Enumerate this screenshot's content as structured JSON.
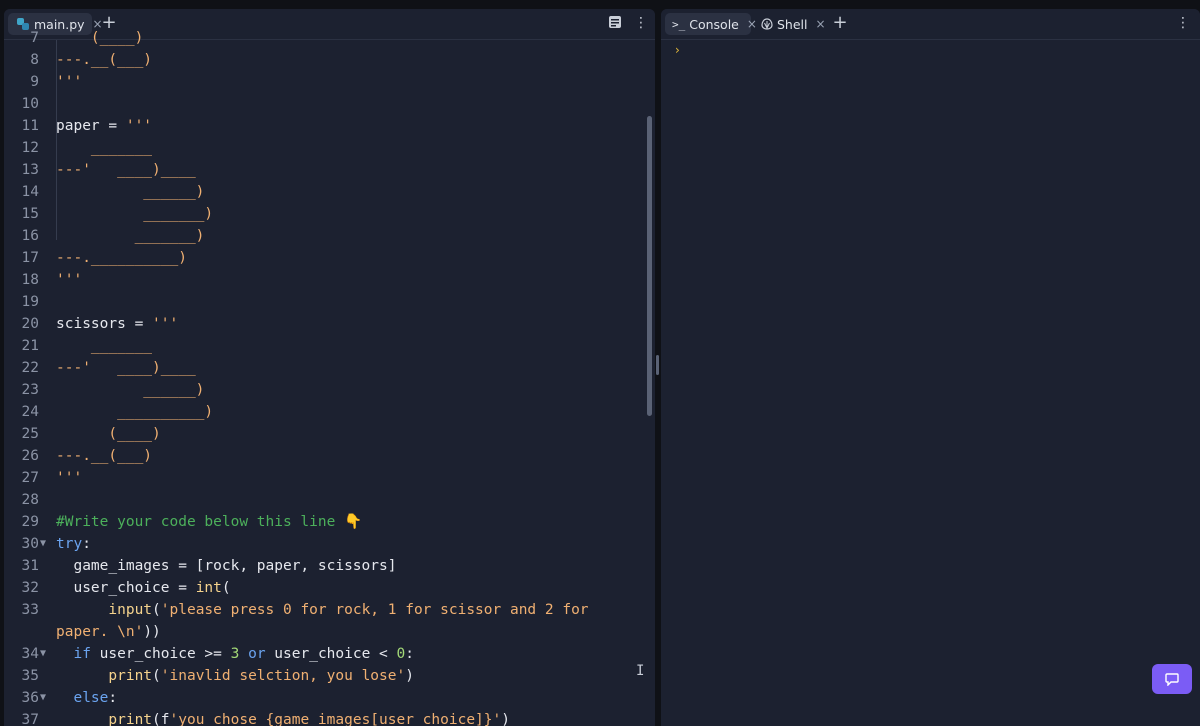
{
  "editor": {
    "tab_label": "main.py",
    "tab_close": "×",
    "add_tab": "+",
    "menu": "⋮"
  },
  "console": {
    "tabs": [
      {
        "label": "Console",
        "icon": ">_",
        "close": "×"
      },
      {
        "label": "Shell",
        "icon": "shell-icon",
        "close": "×"
      }
    ],
    "add_tab": "+",
    "menu": "⋮",
    "prompt": "›"
  },
  "code": [
    {
      "n": "7",
      "t": [
        [
          "str",
          "    (____)"
        ]
      ]
    },
    {
      "n": "8",
      "t": [
        [
          "str",
          "---.__(___)"
        ]
      ]
    },
    {
      "n": "9",
      "t": [
        [
          "str",
          "'''"
        ]
      ]
    },
    {
      "n": "10",
      "t": []
    },
    {
      "n": "11",
      "t": [
        [
          "plain",
          "paper = "
        ],
        [
          "str",
          "'''"
        ]
      ]
    },
    {
      "n": "12",
      "t": [
        [
          "str",
          "    _______"
        ]
      ]
    },
    {
      "n": "13",
      "t": [
        [
          "str",
          "---'   ____)____"
        ]
      ]
    },
    {
      "n": "14",
      "t": [
        [
          "str",
          "          ______)"
        ]
      ]
    },
    {
      "n": "15",
      "t": [
        [
          "str",
          "          _______)"
        ]
      ]
    },
    {
      "n": "16",
      "t": [
        [
          "str",
          "         _______)"
        ]
      ]
    },
    {
      "n": "17",
      "t": [
        [
          "str",
          "---.__________)"
        ]
      ]
    },
    {
      "n": "18",
      "t": [
        [
          "str",
          "'''"
        ]
      ]
    },
    {
      "n": "19",
      "t": []
    },
    {
      "n": "20",
      "t": [
        [
          "plain",
          "scissors = "
        ],
        [
          "str",
          "'''"
        ]
      ]
    },
    {
      "n": "21",
      "t": [
        [
          "str",
          "    _______"
        ]
      ]
    },
    {
      "n": "22",
      "t": [
        [
          "str",
          "---'   ____)____"
        ]
      ]
    },
    {
      "n": "23",
      "t": [
        [
          "str",
          "          ______)"
        ]
      ]
    },
    {
      "n": "24",
      "t": [
        [
          "str",
          "       __________)"
        ]
      ]
    },
    {
      "n": "25",
      "t": [
        [
          "str",
          "      (____)"
        ]
      ]
    },
    {
      "n": "26",
      "t": [
        [
          "str",
          "---.__(___)"
        ]
      ]
    },
    {
      "n": "27",
      "t": [
        [
          "str",
          "'''"
        ]
      ]
    },
    {
      "n": "28",
      "t": []
    },
    {
      "n": "29",
      "t": [
        [
          "cmt",
          "#Write your code below this line 👇"
        ]
      ]
    },
    {
      "n": "30",
      "fold": "▼",
      "t": [
        [
          "kw",
          "try"
        ],
        [
          "plain",
          ":"
        ]
      ]
    },
    {
      "n": "31",
      "t": [
        [
          "plain",
          "  game_images = [rock, paper, scissors]"
        ]
      ]
    },
    {
      "n": "32",
      "t": [
        [
          "plain",
          "  user_choice = "
        ],
        [
          "fn",
          "int"
        ],
        [
          "plain",
          "("
        ]
      ]
    },
    {
      "n": "33",
      "t": [
        [
          "plain",
          "      "
        ],
        [
          "fn",
          "input"
        ],
        [
          "plain",
          "("
        ],
        [
          "str",
          "'please press 0 for rock, 1 for scissor and 2 for"
        ]
      ]
    },
    {
      "n": "",
      "t": [
        [
          "str",
          "paper. \\n'"
        ],
        [
          "plain",
          "))"
        ]
      ]
    },
    {
      "n": "34",
      "fold": "▼",
      "t": [
        [
          "plain",
          "  "
        ],
        [
          "kw",
          "if"
        ],
        [
          "plain",
          " user_choice >= "
        ],
        [
          "num",
          "3"
        ],
        [
          "plain",
          " "
        ],
        [
          "kw",
          "or"
        ],
        [
          "plain",
          " user_choice < "
        ],
        [
          "num",
          "0"
        ],
        [
          "plain",
          ":"
        ]
      ]
    },
    {
      "n": "35",
      "t": [
        [
          "plain",
          "      "
        ],
        [
          "fn",
          "print"
        ],
        [
          "plain",
          "("
        ],
        [
          "str",
          "'inavlid selction, you lose'"
        ],
        [
          "plain",
          ")"
        ]
      ]
    },
    {
      "n": "36",
      "fold": "▼",
      "t": [
        [
          "plain",
          "  "
        ],
        [
          "kw",
          "else"
        ],
        [
          "plain",
          ":"
        ]
      ]
    },
    {
      "n": "37",
      "t": [
        [
          "plain",
          "      "
        ],
        [
          "fn",
          "print"
        ],
        [
          "plain",
          "(f"
        ],
        [
          "str",
          "'you chose {game_images[user_choice]}'"
        ],
        [
          "plain",
          ")"
        ]
      ]
    }
  ]
}
